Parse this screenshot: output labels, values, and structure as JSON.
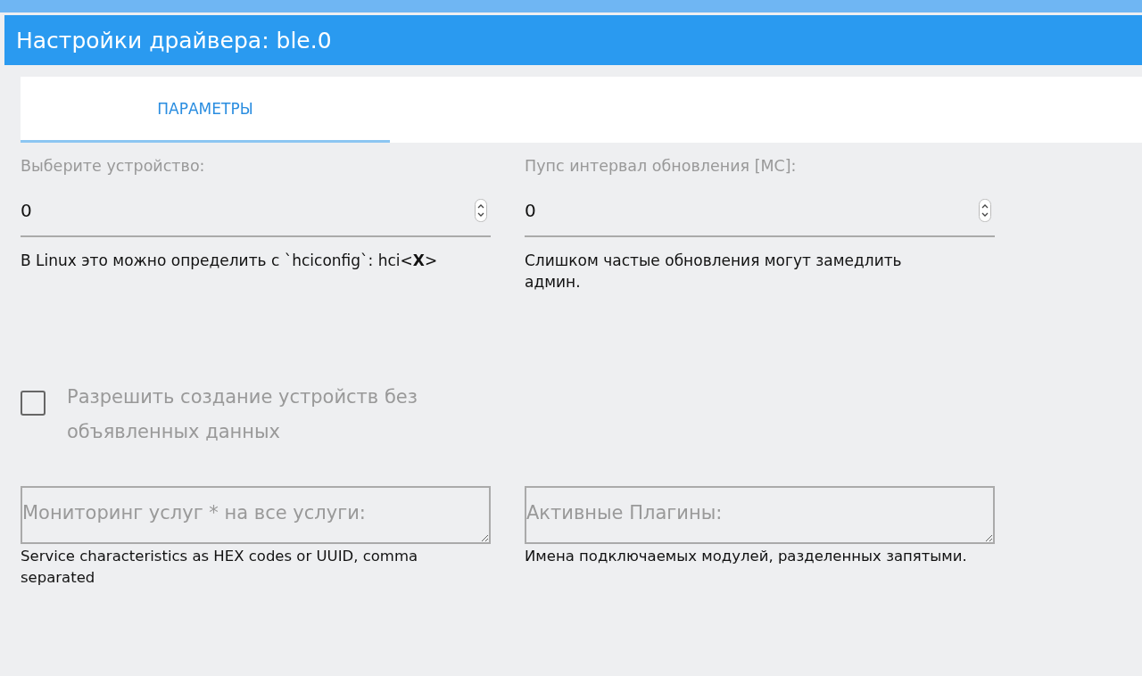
{
  "window": {
    "title": "Настройки драйвера: ble.0"
  },
  "tabs": [
    {
      "label": "ПАРАМЕТРЫ",
      "selected": true
    }
  ],
  "fields": [
    {
      "label": "Выберите устройство:",
      "value": "0",
      "help": "В Linux это можно определить с `hciconfig`: hci<**X**>"
    },
    {
      "label": "Пупс интервал обновления [МС]:",
      "value": "0",
      "help": "Слишком частые обновления могут замедлить админ."
    }
  ],
  "checkbox": {
    "label": "Разрешить создание устройств без объявленных данных",
    "checked": false
  },
  "text_areas": [
    {
      "placeholder": "Мониторинг услуг * на все услуги:",
      "help": "Service characteristics as HEX codes or UUID, comma separated"
    },
    {
      "placeholder": "Активные Плагины:",
      "help": "Имена подключаемых модулей, разделенных запятыми."
    }
  ]
}
